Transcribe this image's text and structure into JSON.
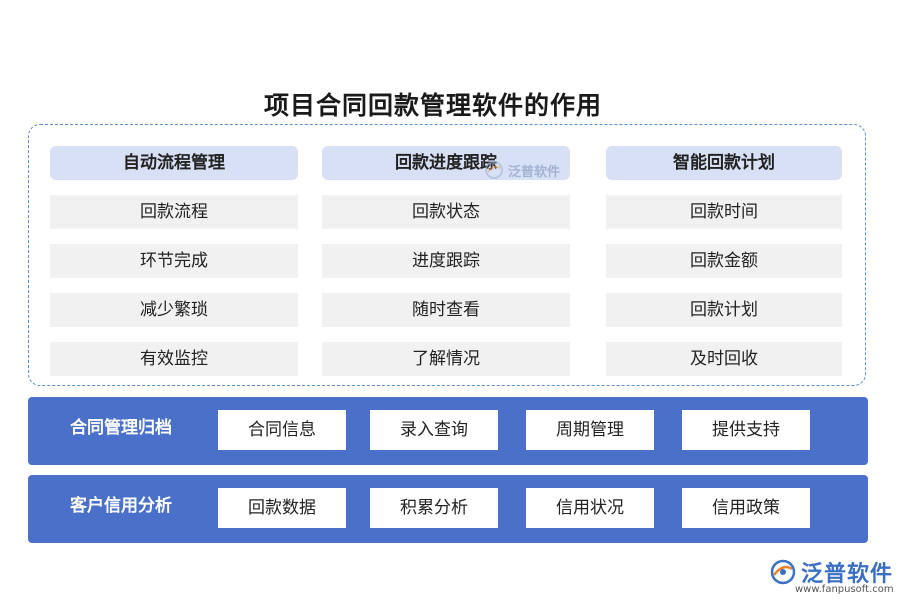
{
  "title": "项目合同回款管理软件的作用",
  "columns": [
    {
      "header": "自动流程管理",
      "items": [
        "回款流程",
        "环节完成",
        "减少繁琐",
        "有效监控"
      ]
    },
    {
      "header": "回款进度跟踪",
      "items": [
        "回款状态",
        "进度跟踪",
        "随时查看",
        "了解情况"
      ]
    },
    {
      "header": "智能回款计划",
      "items": [
        "回款时间",
        "回款金额",
        "回款计划",
        "及时回收"
      ]
    }
  ],
  "bands": [
    {
      "label": "合同管理归档",
      "items": [
        "合同信息",
        "录入查询",
        "周期管理",
        "提供支持"
      ]
    },
    {
      "label": "客户信用分析",
      "items": [
        "回款数据",
        "积累分析",
        "信用状况",
        "信用政策"
      ]
    }
  ],
  "watermark": {
    "text": "泛普软件"
  },
  "logo": {
    "text": "泛普软件",
    "url": "www.fanpusoft.com"
  },
  "colors": {
    "band": "#4a70c9",
    "header": "#d7e0f5",
    "item": "#f1f1f1",
    "dashed_border": "#5b8fc9",
    "logo": "#3b6fc4"
  }
}
